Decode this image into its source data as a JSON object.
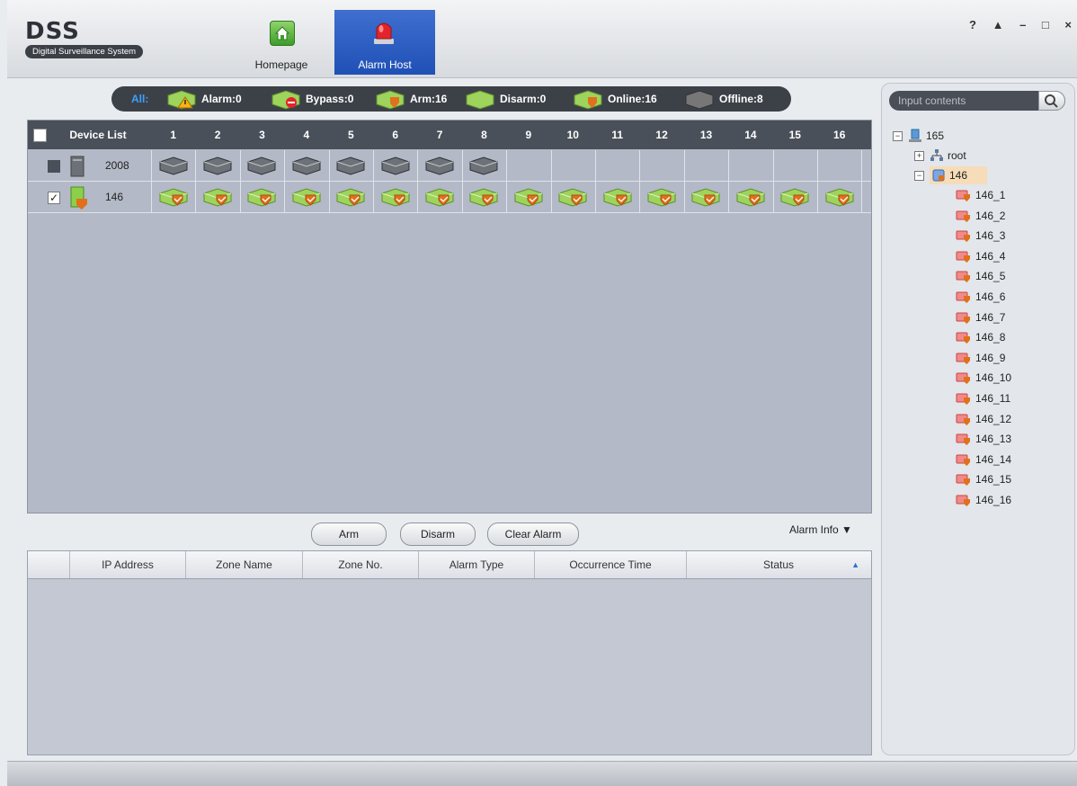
{
  "app": {
    "logo": "DSS",
    "logo_subtitle": "Digital Surveillance System"
  },
  "nav": {
    "home_label": "Homepage",
    "alarm_label": "Alarm Host"
  },
  "window_controls": {
    "help": "?",
    "lock": "🔒",
    "minimize": "–",
    "maximize": "□",
    "close": "×"
  },
  "status": {
    "all": "All:",
    "alarm": "Alarm:0",
    "bypass": "Bypass:0",
    "arm": "Arm:16",
    "disarm": "Disarm:0",
    "online": "Online:16",
    "offline": "Offline:8"
  },
  "grid": {
    "header_label": "Device List",
    "columns": [
      "1",
      "2",
      "3",
      "4",
      "5",
      "6",
      "7",
      "8",
      "9",
      "10",
      "11",
      "12",
      "13",
      "14",
      "15",
      "16"
    ],
    "rows": [
      {
        "name": "2008",
        "state": "offline",
        "zone_count": 8
      },
      {
        "name": "146",
        "state": "armed",
        "zone_count": 16
      }
    ]
  },
  "actions": {
    "arm": "Arm",
    "disarm": "Disarm",
    "clear_alarm": "Clear Alarm",
    "alarm_info": "Alarm Info ▼"
  },
  "alarm_table": {
    "columns": [
      "IP Address",
      "Zone Name",
      "Zone No.",
      "Alarm Type",
      "Occurrence Time",
      "Status"
    ]
  },
  "tree": {
    "search_placeholder": "Input contents",
    "root_label": "165",
    "child_root": "root",
    "device": "146",
    "zones": [
      "146_1",
      "146_2",
      "146_3",
      "146_4",
      "146_5",
      "146_6",
      "146_7",
      "146_8",
      "146_9",
      "146_10",
      "146_11",
      "146_12",
      "146_13",
      "146_14",
      "146_15",
      "146_16"
    ]
  },
  "colors": {
    "nav_active": "#1f50b6",
    "header_bg": "#4a5059",
    "armed": "#8ccf4a",
    "shield": "#e0701c"
  }
}
